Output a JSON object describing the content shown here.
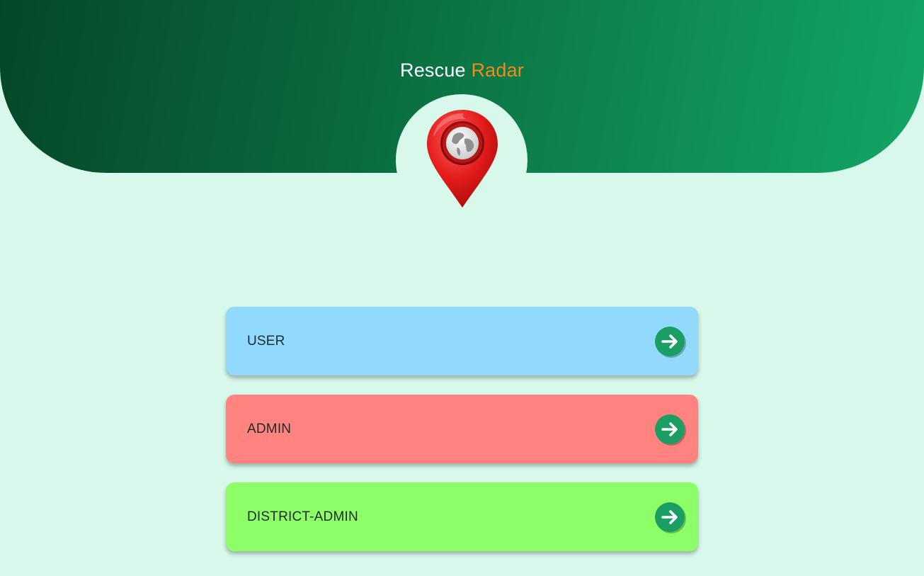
{
  "app": {
    "title_part1": "Rescue",
    "title_part2": "Radar",
    "logo_icon": "map-pin-globe-icon"
  },
  "colors": {
    "header_gradient_start": "#05472a",
    "header_gradient_end": "#13a565",
    "background": "#d7f8ea",
    "title_accent": "#f08a1a",
    "arrow_button": "#1a9e64"
  },
  "roles": [
    {
      "label": "USER",
      "color": "#91dafd",
      "icon": "arrow-right-icon"
    },
    {
      "label": "ADMIN",
      "color": "#ff8480",
      "icon": "arrow-right-icon"
    },
    {
      "label": "DISTRICT-ADMIN",
      "color": "#8dfd68",
      "icon": "arrow-right-icon"
    }
  ]
}
